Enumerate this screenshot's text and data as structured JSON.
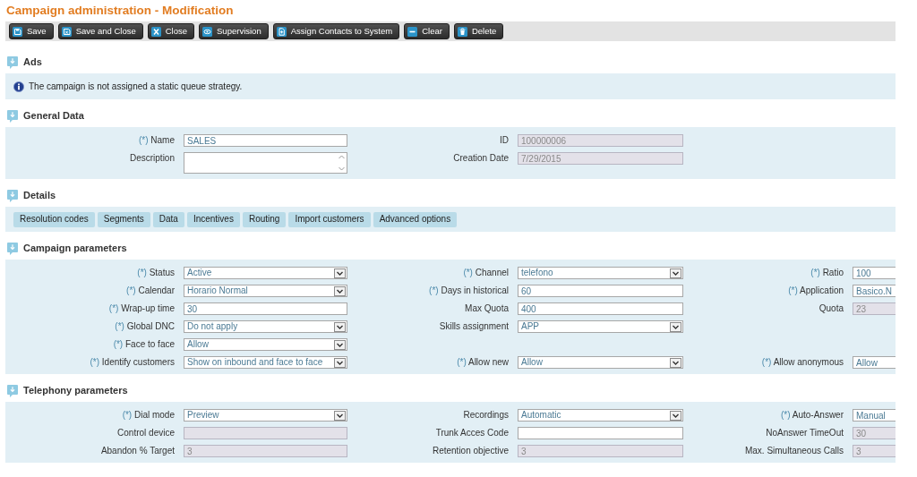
{
  "title": "Campaign administration - Modification",
  "toolbar": [
    {
      "label": "Save",
      "kind": "save"
    },
    {
      "label": "Save and Close",
      "kind": "save_close"
    },
    {
      "label": "Close",
      "kind": "close"
    },
    {
      "label": "Supervision",
      "kind": "supervision"
    },
    {
      "label": "Assign Contacts to System",
      "kind": "assign"
    },
    {
      "label": "Clear",
      "kind": "clear"
    },
    {
      "label": "Delete",
      "kind": "delete"
    }
  ],
  "sections": [
    {
      "title": "Ads",
      "kind": "messages",
      "messages": [
        "The campaign is not assigned a static queue strategy."
      ]
    },
    {
      "title": "General Data",
      "kind": "form",
      "rows": [
        {
          "fields": [
            {
              "marker": "(*)",
              "label": "Name",
              "kind": "text",
              "value": "SALES",
              "disabled": false
            },
            {
              "label": "ID",
              "kind": "text",
              "value": "100000006",
              "disabled": true
            }
          ]
        },
        {
          "fields": [
            {
              "label": "Description",
              "kind": "textarea",
              "disabled": false
            },
            {
              "label": "Creation Date",
              "kind": "text",
              "value": "7/29/2015",
              "disabled": true
            }
          ]
        }
      ]
    },
    {
      "title": "Details",
      "kind": "buttons",
      "buttons": [
        "Resolution codes",
        "Segments",
        "Data",
        "Incentives",
        "Routing",
        "Import customers",
        "Advanced options"
      ]
    },
    {
      "title": "Campaign parameters",
      "kind": "form",
      "rows": [
        {
          "fields": [
            {
              "marker": "(*)",
              "label": "Status",
              "kind": "select",
              "value": "Active",
              "disabled": false
            },
            {
              "marker": "(*)",
              "label": "Channel",
              "kind": "select",
              "value": "telefono",
              "disabled": false
            },
            {
              "marker": "(*)",
              "label": "Ratio",
              "kind": "text",
              "value": "100",
              "disabled": false
            }
          ]
        },
        {
          "fields": [
            {
              "marker": "(*)",
              "label": "Calendar",
              "kind": "select",
              "value": "Horario Normal",
              "disabled": false
            },
            {
              "marker": "(*)",
              "label": "Days in historical",
              "kind": "text",
              "value": "60",
              "disabled": false
            },
            {
              "marker": "(*)",
              "label": "Application",
              "kind": "text",
              "value": "Basico.N",
              "disabled": false
            }
          ]
        },
        {
          "fields": [
            {
              "marker": "(*)",
              "label": "Wrap-up time",
              "kind": "text",
              "value": "30",
              "disabled": false
            },
            {
              "label": "Max Quota",
              "kind": "text",
              "value": "400",
              "disabled": false
            },
            {
              "label": "Quota",
              "kind": "text",
              "value": "23",
              "disabled": true
            }
          ]
        },
        {
          "fields": [
            {
              "marker": "(*)",
              "label": "Global DNC",
              "kind": "select",
              "value": "Do not apply",
              "disabled": false
            },
            {
              "label": "Skills assignment",
              "kind": "select",
              "value": "APP",
              "disabled": false
            }
          ]
        },
        {
          "fields": [
            {
              "marker": "(*)",
              "label": "Face to face",
              "kind": "select",
              "value": "Allow",
              "disabled": false
            }
          ]
        },
        {
          "fields": [
            {
              "marker": "(*)",
              "label": "Identify customers",
              "kind": "select",
              "value": "Show on inbound and face to face",
              "disabled": false
            },
            {
              "marker": "(*)",
              "label": "Allow new",
              "kind": "select",
              "value": "Allow",
              "disabled": false
            },
            {
              "marker": "(*)",
              "label": "Allow anonymous",
              "kind": "text",
              "value": "Allow",
              "disabled": false
            }
          ]
        }
      ]
    },
    {
      "title": "Telephony parameters",
      "kind": "form",
      "rows": [
        {
          "fields": [
            {
              "marker": "(*)",
              "label": "Dial mode",
              "kind": "select",
              "value": "Preview",
              "disabled": false
            },
            {
              "label": "Recordings",
              "kind": "select",
              "value": "Automatic",
              "disabled": false
            },
            {
              "marker": "(*)",
              "label": "Auto-Answer",
              "kind": "text",
              "value": "Manual",
              "disabled": false
            }
          ]
        },
        {
          "fields": [
            {
              "label": "Control device",
              "kind": "text",
              "disabled": true
            },
            {
              "label": "Trunk Acces Code",
              "kind": "text",
              "disabled": false
            },
            {
              "label": "NoAnswer TimeOut",
              "kind": "text",
              "value": "30",
              "disabled": true
            }
          ]
        },
        {
          "fields": [
            {
              "label": "Abandon % Target",
              "kind": "text",
              "value": "3",
              "disabled": true
            },
            {
              "label": "Retention objective",
              "kind": "text",
              "value": "3",
              "disabled": true
            },
            {
              "label": "Max. Simultaneous Calls",
              "kind": "text",
              "value": "3",
              "disabled": true
            }
          ]
        }
      ]
    }
  ]
}
